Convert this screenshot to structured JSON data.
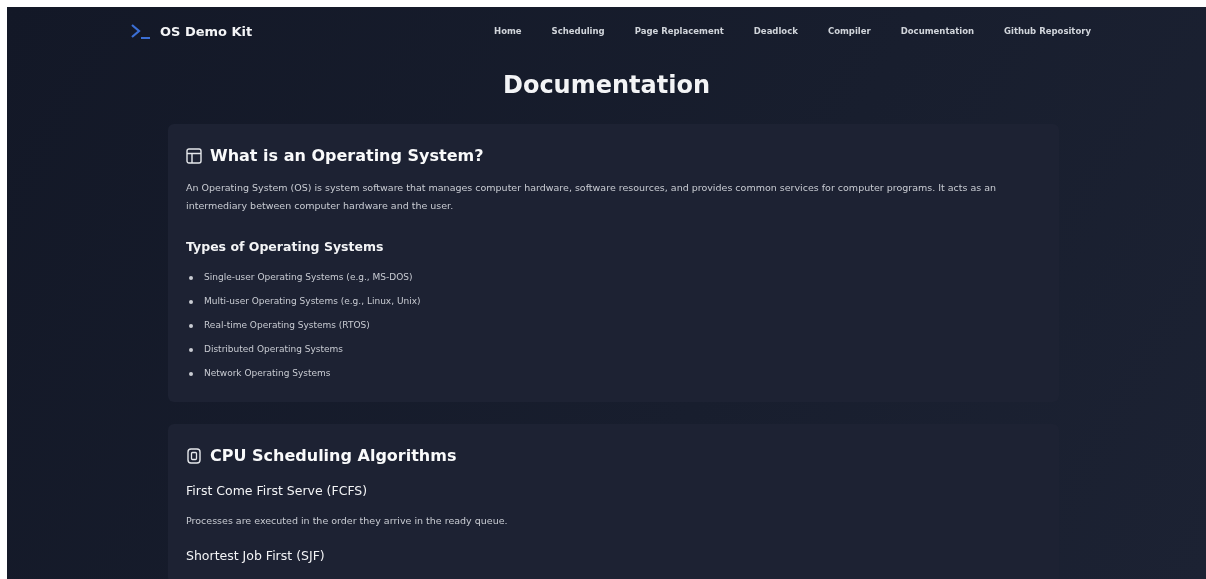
{
  "brand": {
    "title": "OS Demo Kit"
  },
  "nav": [
    "Home",
    "Scheduling",
    "Page Replacement",
    "Deadlock",
    "Compiler",
    "Documentation",
    "Github Repository"
  ],
  "page_title": "Documentation",
  "sections": [
    {
      "title": "What is an Operating System?",
      "blocks": [
        {
          "kind": "paragraph",
          "text": "An Operating System (OS) is system software that manages computer hardware, software resources, and provides common services for computer programs. It acts as an intermediary between computer hardware and the user."
        },
        {
          "kind": "subheading",
          "text": "Types of Operating Systems"
        },
        {
          "kind": "list",
          "items": [
            "Single-user Operating Systems (e.g., MS-DOS)",
            "Multi-user Operating Systems (e.g., Linux, Unix)",
            "Real-time Operating Systems (RTOS)",
            "Distributed Operating Systems",
            "Network Operating Systems"
          ]
        }
      ]
    },
    {
      "title": "CPU Scheduling Algorithms",
      "blocks": [
        {
          "kind": "subheading",
          "text": "First Come First Serve (FCFS)"
        },
        {
          "kind": "paragraph",
          "text": "Processes are executed in the order they arrive in the ready queue."
        },
        {
          "kind": "subheading",
          "text": "Shortest Job First (SJF)"
        }
      ]
    }
  ]
}
